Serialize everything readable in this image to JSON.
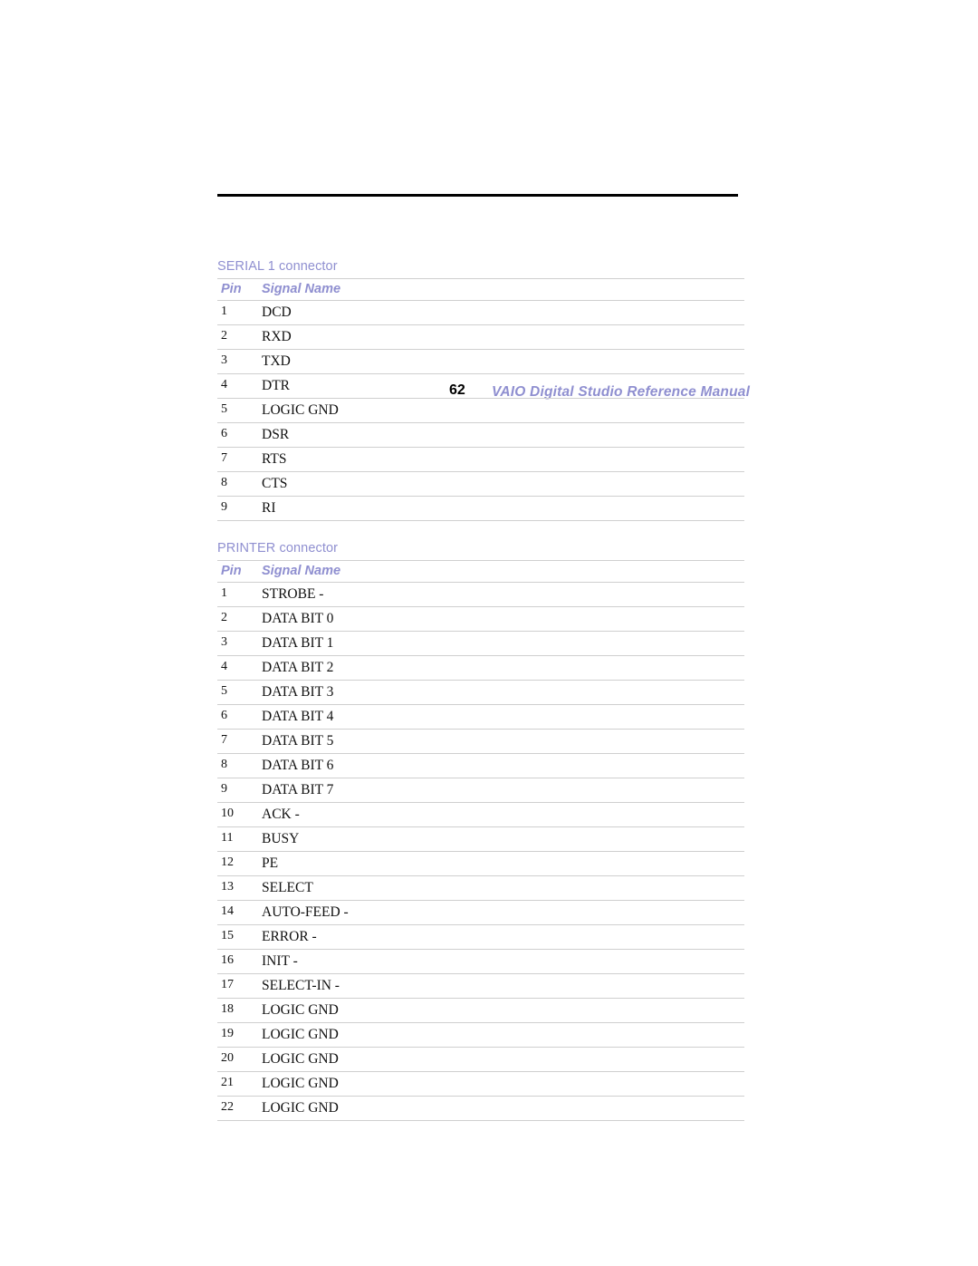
{
  "header": {
    "page_number": "62",
    "title": "VAIO Digital Studio Reference Manual",
    "accent_color": "#8f8fd0"
  },
  "tables": [
    {
      "caption": "SERIAL 1 connector",
      "columns": {
        "pin": "Pin",
        "signal": "Signal Name"
      },
      "rows": [
        {
          "pin": "1",
          "signal": "DCD"
        },
        {
          "pin": "2",
          "signal": "RXD"
        },
        {
          "pin": "3",
          "signal": "TXD"
        },
        {
          "pin": "4",
          "signal": "DTR"
        },
        {
          "pin": "5",
          "signal": "LOGIC GND"
        },
        {
          "pin": "6",
          "signal": "DSR"
        },
        {
          "pin": "7",
          "signal": "RTS"
        },
        {
          "pin": "8",
          "signal": "CTS"
        },
        {
          "pin": "9",
          "signal": "RI"
        }
      ]
    },
    {
      "caption": "PRINTER connector",
      "columns": {
        "pin": "Pin",
        "signal": "Signal Name"
      },
      "rows": [
        {
          "pin": "1",
          "signal": "STROBE -"
        },
        {
          "pin": "2",
          "signal": "DATA BIT 0"
        },
        {
          "pin": "3",
          "signal": "DATA BIT 1"
        },
        {
          "pin": "4",
          "signal": "DATA BIT 2"
        },
        {
          "pin": "5",
          "signal": "DATA BIT 3"
        },
        {
          "pin": "6",
          "signal": "DATA BIT 4"
        },
        {
          "pin": "7",
          "signal": "DATA BIT 5"
        },
        {
          "pin": "8",
          "signal": "DATA BIT 6"
        },
        {
          "pin": "9",
          "signal": "DATA BIT 7"
        },
        {
          "pin": "10",
          "signal": "ACK -"
        },
        {
          "pin": "11",
          "signal": "BUSY"
        },
        {
          "pin": "12",
          "signal": "PE"
        },
        {
          "pin": "13",
          "signal": "SELECT"
        },
        {
          "pin": "14",
          "signal": "AUTO-FEED -"
        },
        {
          "pin": "15",
          "signal": "ERROR -"
        },
        {
          "pin": "16",
          "signal": "INIT -"
        },
        {
          "pin": "17",
          "signal": "SELECT-IN -"
        },
        {
          "pin": "18",
          "signal": "LOGIC GND"
        },
        {
          "pin": "19",
          "signal": "LOGIC GND"
        },
        {
          "pin": "20",
          "signal": "LOGIC GND"
        },
        {
          "pin": "21",
          "signal": "LOGIC GND"
        },
        {
          "pin": "22",
          "signal": "LOGIC GND"
        }
      ]
    }
  ]
}
